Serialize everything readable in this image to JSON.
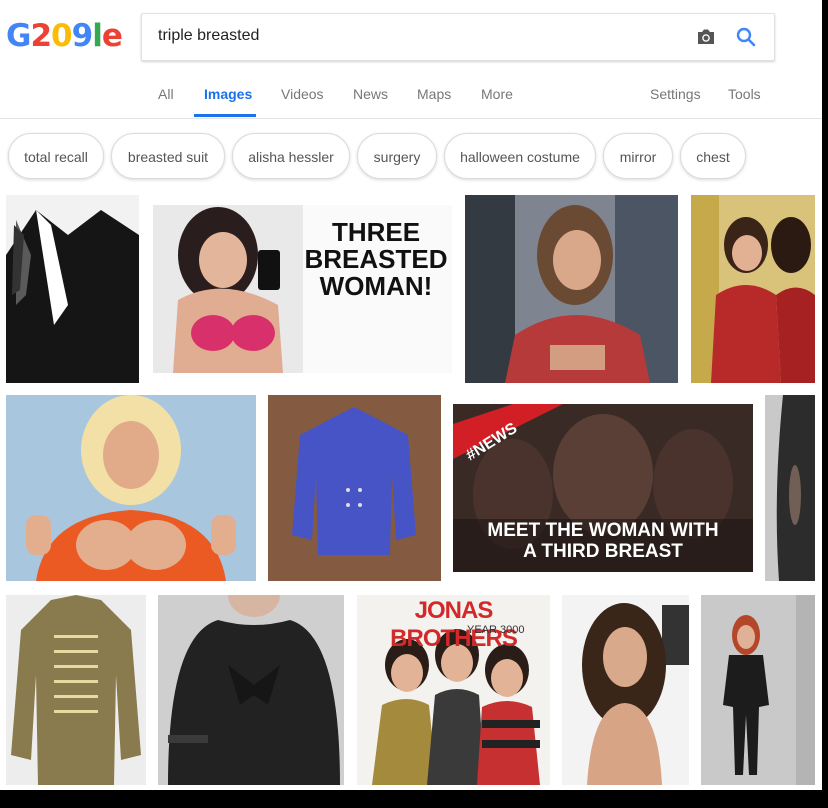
{
  "logo": {
    "letters": [
      "G",
      "2",
      "0",
      "9",
      "l",
      "e"
    ],
    "colors": [
      "#4285f4",
      "#ea4335",
      "#fbbc05",
      "#4285f4",
      "#34a853",
      "#ea4335"
    ]
  },
  "search": {
    "query": "triple breasted"
  },
  "tabs": [
    "All",
    "Images",
    "Videos",
    "News",
    "Maps",
    "More"
  ],
  "settings_tabs": [
    "Settings",
    "Tools"
  ],
  "chips": [
    "total recall",
    "breasted suit",
    "alisha hessler",
    "surgery",
    "halloween costume",
    "mirror",
    "chest"
  ],
  "results": {
    "three_breasted_text": [
      "THREE",
      "BREASTED",
      "WOMAN!"
    ],
    "news_badge": "#NEWS",
    "meet_text": [
      "MEET THE WOMAN WITH",
      "A THIRD BREAST"
    ],
    "jonas_title": "JONAS BROTHERS",
    "jonas_sub": "YEAR 3000"
  },
  "colors": {
    "accent": "#1a73e8",
    "tab_inactive": "#777777",
    "chip_text": "#555555"
  }
}
